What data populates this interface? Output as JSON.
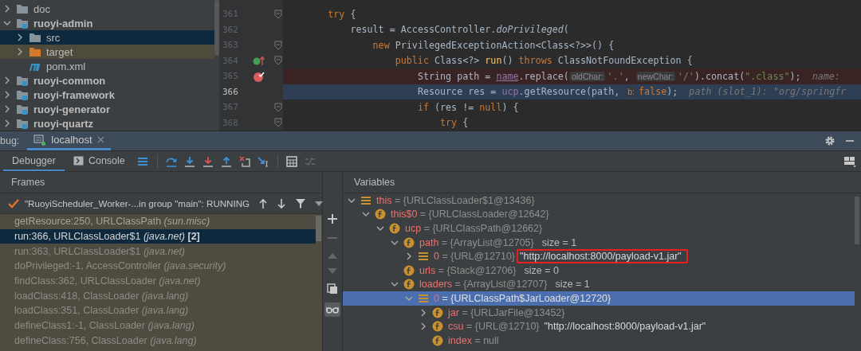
{
  "project_tree": {
    "items": [
      {
        "label": "doc",
        "kind": "folder",
        "expanded": false,
        "selected": false
      },
      {
        "label": "ruoyi-admin",
        "kind": "module",
        "expanded": true,
        "selected": false,
        "children": [
          {
            "label": "src",
            "kind": "folder",
            "expanded": false,
            "selected": true
          },
          {
            "label": "target",
            "kind": "excluded",
            "expanded": false,
            "selected": false
          },
          {
            "label": "pom.xml",
            "kind": "maven",
            "selected": false
          }
        ]
      },
      {
        "label": "ruoyi-common",
        "kind": "module",
        "expanded": false,
        "selected": false
      },
      {
        "label": "ruoyi-framework",
        "kind": "module",
        "expanded": false,
        "selected": false
      },
      {
        "label": "ruoyi-generator",
        "kind": "module",
        "expanded": false,
        "selected": false
      },
      {
        "label": "ruoyi-quartz",
        "kind": "module",
        "expanded": false,
        "selected": false
      }
    ]
  },
  "editor": {
    "lines": [
      {
        "number": "361",
        "breakpoint": false,
        "current": false,
        "fold": true,
        "tokens": [
          {
            "text": "try",
            "kind": "keyword"
          },
          {
            "text": " {",
            "kind": "plain"
          }
        ],
        "children": [
          {
            "number": "362",
            "breakpoint": false,
            "current": false,
            "fold": false,
            "tokens": [
              {
                "text": "result = AccessController.",
                "kind": "plain"
              },
              {
                "text": "doPrivileged",
                "kind": "italic"
              },
              {
                "text": "(",
                "kind": "plain"
              }
            ],
            "children": [
              {
                "number": "363",
                "breakpoint": false,
                "current": false,
                "fold": true,
                "tokens": [
                  {
                    "text": "new",
                    "kind": "keyword"
                  },
                  {
                    "text": " PrivilegedExceptionAction<Class<?>>() {",
                    "kind": "plain"
                  }
                ],
                "children": [
                  {
                    "number": "364",
                    "breakpoint": false,
                    "current": false,
                    "fold": true,
                    "overrides": true,
                    "tokens": [
                      {
                        "text": "public",
                        "kind": "keyword"
                      },
                      {
                        "text": " Class<?> ",
                        "kind": "plain"
                      },
                      {
                        "text": "run",
                        "kind": "method"
                      },
                      {
                        "text": "() ",
                        "kind": "plain"
                      },
                      {
                        "text": "throws",
                        "kind": "keyword"
                      },
                      {
                        "text": " ClassNotFoundException {",
                        "kind": "plain"
                      }
                    ],
                    "children": [
                      {
                        "number": "365",
                        "breakpoint": true,
                        "current": false,
                        "fold": false,
                        "tokens": [
                          {
                            "text": "String path = ",
                            "kind": "plain"
                          },
                          {
                            "text": "name",
                            "kind": "param"
                          },
                          {
                            "text": ".replace(",
                            "kind": "plain"
                          },
                          {
                            "text": "oldChar:",
                            "kind": "hint"
                          },
                          {
                            "text": "'.'",
                            "kind": "string"
                          },
                          {
                            "text": ", ",
                            "kind": "plain"
                          },
                          {
                            "text": "newChar:",
                            "kind": "hint"
                          },
                          {
                            "text": "'/'",
                            "kind": "string"
                          },
                          {
                            "text": ").concat(",
                            "kind": "plain"
                          },
                          {
                            "text": "\".class\"",
                            "kind": "string"
                          },
                          {
                            "text": ");",
                            "kind": "plain"
                          },
                          {
                            "text": "name:",
                            "kind": "inline_value"
                          }
                        ]
                      },
                      {
                        "number": "366",
                        "breakpoint": false,
                        "current": true,
                        "fold": false,
                        "tokens": [
                          {
                            "text": "Resource res = ",
                            "kind": "plain"
                          },
                          {
                            "text": "ucp",
                            "kind": "field"
                          },
                          {
                            "text": ".getResource(path, ",
                            "kind": "plain"
                          },
                          {
                            "text": "b:",
                            "kind": "hint"
                          },
                          {
                            "text": "false",
                            "kind": "keyword"
                          },
                          {
                            "text": ");",
                            "kind": "plain"
                          },
                          {
                            "text": "path (slot_1): \"org/springfr",
                            "kind": "inline_value"
                          }
                        ]
                      },
                      {
                        "number": "367",
                        "breakpoint": false,
                        "current": false,
                        "fold": true,
                        "tokens": [
                          {
                            "text": "if",
                            "kind": "keyword"
                          },
                          {
                            "text": " (res != ",
                            "kind": "plain"
                          },
                          {
                            "text": "null",
                            "kind": "keyword"
                          },
                          {
                            "text": ") {",
                            "kind": "plain"
                          }
                        ],
                        "children": [
                          {
                            "number": "368",
                            "breakpoint": false,
                            "current": false,
                            "fold": true,
                            "tokens": [
                              {
                                "text": "try",
                                "kind": "keyword"
                              },
                              {
                                "text": " {",
                                "kind": "plain"
                              }
                            ]
                          }
                        ]
                      }
                    ]
                  }
                ]
              }
            ]
          }
        ]
      }
    ]
  },
  "debug_panel": {
    "title": "bug:",
    "session_tabs": [
      {
        "label": "localhost",
        "selected": true
      }
    ],
    "view_tabs": [
      {
        "label": "Debugger",
        "kind": "debugger",
        "selected": true
      },
      {
        "label": "Console",
        "kind": "console",
        "selected": false
      }
    ],
    "frames": {
      "header": "Frames",
      "thread": "\"RuoyiScheduler_Worker-...in group \"main\": RUNNING",
      "items": [
        {
          "location": "getResource:250, URLClassPath",
          "package": "(sun.misc)",
          "selected": false
        },
        {
          "location": "run:366, URLClassLoader$1",
          "package": "(java.net)",
          "badge": "[2]",
          "selected": true
        },
        {
          "location": "run:363, URLClassLoader$1",
          "package": "(java.net)",
          "selected": false
        },
        {
          "location": "doPrivileged:-1, AccessController",
          "package": "(java.security)",
          "selected": false
        },
        {
          "location": "findClass:362, URLClassLoader",
          "package": "(java.net)",
          "selected": false
        },
        {
          "location": "loadClass:418, ClassLoader",
          "package": "(java.lang)",
          "selected": false
        },
        {
          "location": "loadClass:351, ClassLoader",
          "package": "(java.lang)",
          "selected": false
        },
        {
          "location": "defineClass1:-1, ClassLoader",
          "package": "(java.lang)",
          "selected": false
        },
        {
          "location": "defineClass:756, ClassLoader",
          "package": "(java.lang)",
          "selected": false
        }
      ]
    },
    "variables": {
      "header": "Variables",
      "nodes": [
        {
          "name": "this",
          "value": "= {URLClassLoader$1@13436}",
          "kind": "list",
          "expanded": true,
          "selected": false,
          "children": [
            {
              "name": "this$0",
              "value": "= {URLClassLoader@12642}",
              "kind": "field",
              "expanded": true,
              "selected": false,
              "children": [
                {
                  "name": "ucp",
                  "value": "= {URLClassPath@12662}",
                  "kind": "field",
                  "expanded": true,
                  "selected": false,
                  "children": [
                    {
                      "name": "path",
                      "value": "= {ArrayList@12705}",
                      "extra": "size = 1",
                      "kind": "field",
                      "expanded": true,
                      "selected": false,
                      "children": [
                        {
                          "name": "0",
                          "value": "= {URL@12710}",
                          "string": "\"http://localhost:8000/payload-v1.jar\"",
                          "boxed": true,
                          "kind": "list",
                          "expanded": false,
                          "selected": false
                        }
                      ]
                    },
                    {
                      "name": "urls",
                      "value": "= {Stack@12706}",
                      "extra": "size = 0",
                      "kind": "field",
                      "selected": false
                    },
                    {
                      "name": "loaders",
                      "value": "= {ArrayList@12707}",
                      "extra": "size = 1",
                      "kind": "field",
                      "expanded": true,
                      "selected": false,
                      "children": [
                        {
                          "name": "0",
                          "value": "= {URLClassPath$JarLoader@12720}",
                          "kind": "list",
                          "expanded": true,
                          "selected": true,
                          "children": [
                            {
                              "name": "jar",
                              "value": "= {URLJarFile@13452}",
                              "kind": "field",
                              "expanded": false,
                              "selected": false
                            },
                            {
                              "name": "csu",
                              "value": "= {URL@12710}",
                              "string": "\"http://localhost:8000/payload-v1.jar\"",
                              "boxed": false,
                              "kind": "field",
                              "expanded": false,
                              "selected": false
                            },
                            {
                              "name": "index",
                              "value": "= null",
                              "kind": "field",
                              "selected": false
                            }
                          ]
                        }
                      ]
                    }
                  ]
                }
              ]
            }
          ]
        }
      ]
    }
  }
}
